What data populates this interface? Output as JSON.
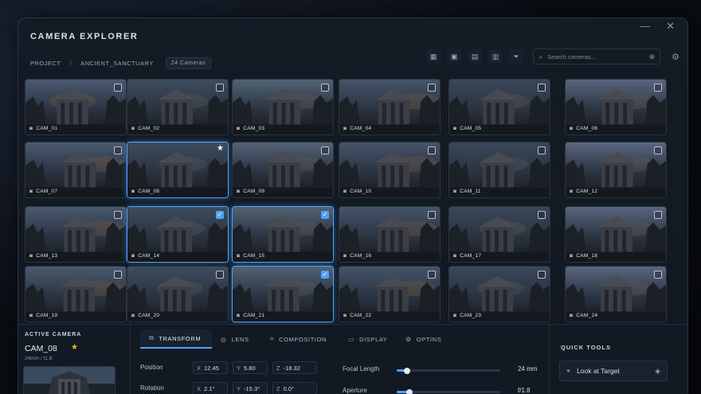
{
  "window": {
    "title": "CAMERA EXPLORER",
    "minimize": "—",
    "close": "✕"
  },
  "breadcrumb": {
    "root": "PROJECT",
    "separator": "/",
    "current": "ANCIENT_SANCTUARY",
    "count": "24 Cameras"
  },
  "toolbar": {
    "icons": [
      "grid-large-icon",
      "grid-medium-icon",
      "grid-small-icon",
      "filmstrip-icon",
      "filter-icon"
    ],
    "search_placeholder": "Search cameras...",
    "zoom_icon": "zoom-icon",
    "settings_icon": "gear-icon"
  },
  "cameras": [
    {
      "label": "CAM_01",
      "selected": false,
      "starred": false,
      "checked": false
    },
    {
      "label": "CAM_02",
      "selected": false,
      "starred": false,
      "checked": false
    },
    {
      "label": "CAM_03",
      "selected": false,
      "starred": false,
      "checked": false
    },
    {
      "label": "CAM_04",
      "selected": false,
      "starred": false,
      "checked": false
    },
    {
      "label": "CAM_05",
      "selected": false,
      "starred": false,
      "checked": false
    },
    {
      "label": "CAM_06",
      "selected": false,
      "starred": false,
      "checked": false
    },
    {
      "label": "CAM_07",
      "selected": false,
      "starred": false,
      "checked": false
    },
    {
      "label": "CAM_08",
      "selected": true,
      "starred": true,
      "checked": false
    },
    {
      "label": "CAM_09",
      "selected": false,
      "starred": false,
      "checked": false
    },
    {
      "label": "CAM_10",
      "selected": false,
      "starred": false,
      "checked": false
    },
    {
      "label": "CAM_11",
      "selected": false,
      "starred": false,
      "checked": false
    },
    {
      "label": "CAM_12",
      "selected": false,
      "starred": false,
      "checked": false
    },
    {
      "label": "CAM_13",
      "selected": false,
      "starred": false,
      "checked": false
    },
    {
      "label": "CAM_14",
      "selected": true,
      "starred": false,
      "checked": true
    },
    {
      "label": "CAM_15",
      "selected": true,
      "starred": false,
      "checked": true
    },
    {
      "label": "CAM_16",
      "selected": false,
      "starred": false,
      "checked": false
    },
    {
      "label": "CAM_17",
      "selected": false,
      "starred": false,
      "checked": false
    },
    {
      "label": "CAM_18",
      "selected": false,
      "starred": false,
      "checked": false
    },
    {
      "label": "CAM_19",
      "selected": false,
      "starred": false,
      "checked": false
    },
    {
      "label": "CAM_20",
      "selected": false,
      "starred": false,
      "checked": false
    },
    {
      "label": "CAM_21",
      "selected": true,
      "starred": false,
      "checked": true
    },
    {
      "label": "CAM_22",
      "selected": false,
      "starred": false,
      "checked": false
    },
    {
      "label": "CAM_23",
      "selected": false,
      "starred": false,
      "checked": false
    },
    {
      "label": "CAM_24",
      "selected": false,
      "starred": false,
      "checked": false
    }
  ],
  "active_camera": {
    "title": "ACTIVE CAMERA",
    "name": "CAM_08",
    "meta": "24mm / f1.8"
  },
  "tabs": [
    {
      "label": "TRANSFORM",
      "icon": "transform-icon",
      "active": true
    },
    {
      "label": "LENS",
      "icon": "lens-icon",
      "active": false
    },
    {
      "label": "COMPOSITION",
      "icon": "composition-icon",
      "active": false
    },
    {
      "label": "DISPLAY",
      "icon": "display-icon",
      "active": false
    },
    {
      "label": "OPTINS",
      "icon": "gear-icon",
      "active": false
    }
  ],
  "transform": {
    "position": {
      "label": "Position",
      "x": "12.45",
      "y": "5.80",
      "z": "-18.32"
    },
    "rotation": {
      "label": "Rotation",
      "x": "2.1°",
      "y": "-15.3°",
      "z": "0.0°"
    }
  },
  "lens": {
    "focal_length": {
      "label": "Focal Length",
      "value": "24 mm",
      "level": 0.1
    },
    "aperture": {
      "label": "Aperture",
      "value": "f/1.8",
      "level": 0.12
    }
  },
  "quick_tools": {
    "title": "QUICK TOOLS",
    "look_at_target": "Look at Target"
  },
  "colors": {
    "accent": "#4da3ff",
    "star": "#f2b233",
    "background": "#0b1017"
  }
}
